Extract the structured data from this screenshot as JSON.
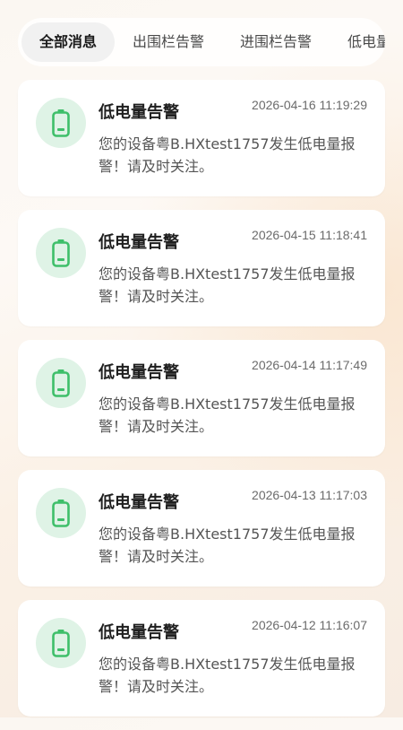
{
  "tabs": [
    {
      "label": "全部消息",
      "active": true
    },
    {
      "label": "出围栏告警",
      "active": false
    },
    {
      "label": "进围栏告警",
      "active": false
    },
    {
      "label": "低电量告警",
      "active": false
    }
  ],
  "colors": {
    "icon_green": "#3fbf6a",
    "icon_bg": "#dff3e6"
  },
  "messages": [
    {
      "icon": "battery-low-icon",
      "title": "低电量告警",
      "time": "2026-04-16 11:19:29",
      "body": "您的设备粤B.HXtest1757发生低电量报警！请及时关注。"
    },
    {
      "icon": "battery-low-icon",
      "title": "低电量告警",
      "time": "2026-04-15 11:18:41",
      "body": "您的设备粤B.HXtest1757发生低电量报警！请及时关注。"
    },
    {
      "icon": "battery-low-icon",
      "title": "低电量告警",
      "time": "2026-04-14 11:17:49",
      "body": "您的设备粤B.HXtest1757发生低电量报警！请及时关注。"
    },
    {
      "icon": "battery-low-icon",
      "title": "低电量告警",
      "time": "2026-04-13 11:17:03",
      "body": "您的设备粤B.HXtest1757发生低电量报警！请及时关注。"
    },
    {
      "icon": "battery-low-icon",
      "title": "低电量告警",
      "time": "2026-04-12 11:16:07",
      "body": "您的设备粤B.HXtest1757发生低电量报警！请及时关注。"
    }
  ]
}
